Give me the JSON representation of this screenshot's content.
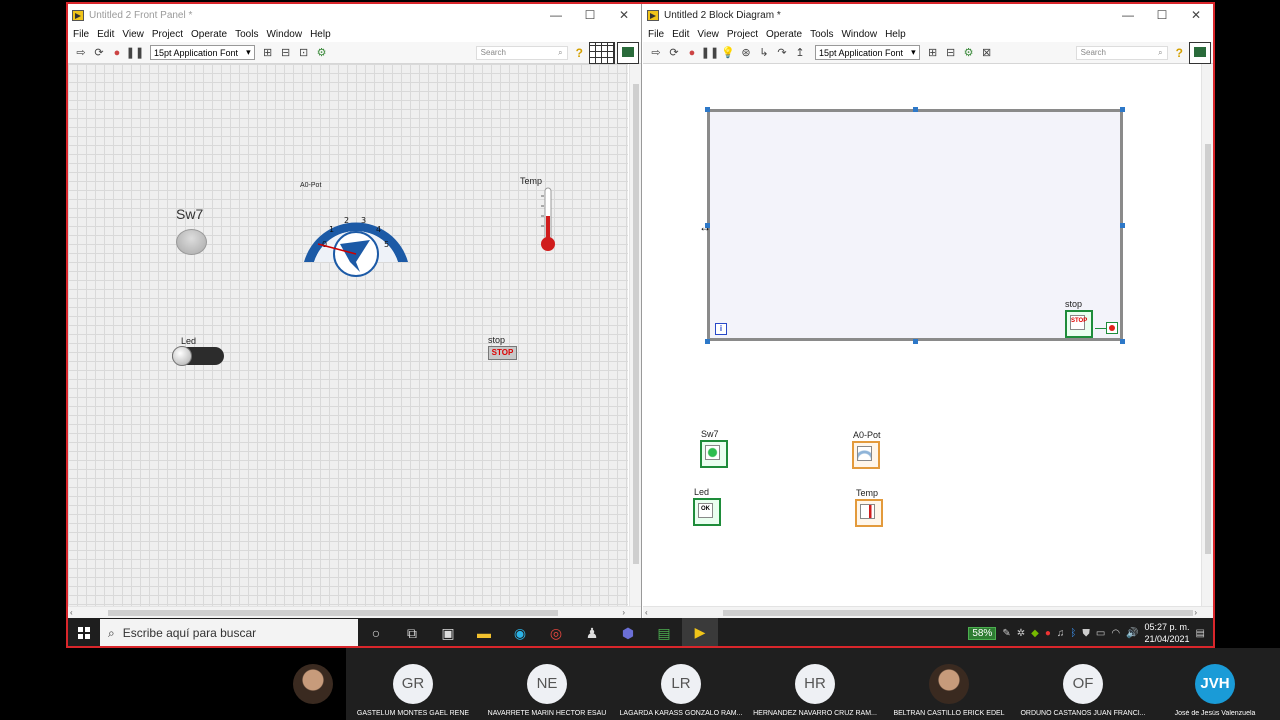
{
  "front_panel": {
    "title": "Untitled 2 Front Panel *",
    "menu": [
      "File",
      "Edit",
      "View",
      "Project",
      "Operate",
      "Tools",
      "Window",
      "Help"
    ],
    "font": "15pt Application Font",
    "search_placeholder": "Search",
    "controls": {
      "sw7_label": "Sw7",
      "pot_label": "A0-Pot",
      "gauge_ticks": [
        "0",
        "1",
        "2",
        "3",
        "4",
        "5"
      ],
      "temp_label": "Temp",
      "led_label": "Led",
      "stop_label": "stop",
      "stop_text": "STOP"
    }
  },
  "block_diagram": {
    "title": "Untitled 2 Block Diagram *",
    "menu": [
      "File",
      "Edit",
      "View",
      "Project",
      "Operate",
      "Tools",
      "Window",
      "Help"
    ],
    "font": "15pt Application Font",
    "search_placeholder": "Search",
    "iteration_terminal": "i",
    "terminals": {
      "stop_label": "stop",
      "stop_text": "STOP",
      "sw7_label": "Sw7",
      "pot_label": "A0-Pot",
      "led_label": "Led",
      "led_text": "OK",
      "temp_label": "Temp"
    }
  },
  "taskbar": {
    "search_placeholder": "Escribe aquí para buscar",
    "battery": "58%",
    "time": "05:27 p. m.",
    "date": "21/04/2021"
  },
  "participants": [
    {
      "initials": "",
      "name": "GASTELUM MONTES GAEL RENE",
      "photo": true
    },
    {
      "initials": "GR",
      "name": "GASTELUM MONTES GAEL RENE"
    },
    {
      "initials": "NE",
      "name": "NAVARRETE MARIN HECTOR ESAU"
    },
    {
      "initials": "LR",
      "name": "LAGARDA KARASS GONZALO RAM..."
    },
    {
      "initials": "HR",
      "name": "HERNÁNDEZ NAVARRO CRUZ RAM..."
    },
    {
      "initials": "",
      "name": "BELTRAN CASTILLO ERICK EDEL",
      "photo": true
    },
    {
      "initials": "OF",
      "name": "ORDUÑO CASTAÑOS JUAN FRANCI..."
    },
    {
      "initials": "JVH",
      "name": "José de Jesús Valenzuela"
    }
  ],
  "colors": {
    "screen_border": "#d9262b",
    "loop_border": "#8a8a8a",
    "boolean_terminal": "#1e8c3a",
    "numeric_terminal": "#e39a3b",
    "gauge_blue": "#1c5aa6"
  }
}
